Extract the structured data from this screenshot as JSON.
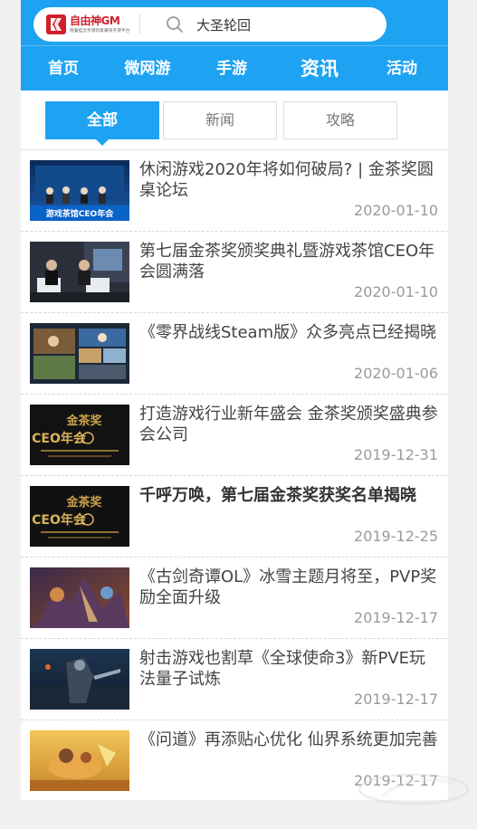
{
  "header": {
    "logo_title": "自由神GM",
    "logo_sub": "陪着挂念手游玩家最快手游平台",
    "search_value": "大圣轮回"
  },
  "nav": [
    {
      "label": "首页"
    },
    {
      "label": "微网游"
    },
    {
      "label": "手游"
    },
    {
      "label": "资讯"
    },
    {
      "label": "活动"
    }
  ],
  "tabs": [
    {
      "label": "全部"
    },
    {
      "label": "新闻"
    },
    {
      "label": "攻略"
    }
  ],
  "articles": [
    {
      "title": "休闲游戏2020年将如何破局? | 金茶奖圆桌论坛",
      "date": "2020-01-10",
      "bold": false,
      "thumb_caption": "游戏茶馆CEO年会"
    },
    {
      "title": "第七届金茶奖颁奖典礼暨游戏茶馆CEO年会圆满落",
      "date": "2020-01-10",
      "bold": false,
      "thumb_caption": ""
    },
    {
      "title": "《零界战线Steam版》众多亮点已经揭晓",
      "date": "2020-01-06",
      "bold": false,
      "thumb_caption": ""
    },
    {
      "title": "打造游戏行业新年盛会 金茶奖颁奖盛典参会公司",
      "date": "2019-12-31",
      "bold": false,
      "thumb_caption": "CEO年会"
    },
    {
      "title": "千呼万唤，第七届金茶奖获奖名单揭晓",
      "date": "2019-12-25",
      "bold": true,
      "thumb_caption": "CEO年会"
    },
    {
      "title": "《古剑奇谭OL》冰雪主题月将至，PVP奖励全面升级",
      "date": "2019-12-17",
      "bold": false,
      "thumb_caption": ""
    },
    {
      "title": "射击游戏也割草《全球使命3》新PVE玩法量子试炼",
      "date": "2019-12-17",
      "bold": false,
      "thumb_caption": ""
    },
    {
      "title": "《问道》再添贴心优化 仙界系统更加完善",
      "date": "2019-12-17",
      "bold": false,
      "thumb_caption": ""
    }
  ],
  "colors": {
    "accent": "#1ea2f2",
    "brand_red": "#d0202a"
  }
}
